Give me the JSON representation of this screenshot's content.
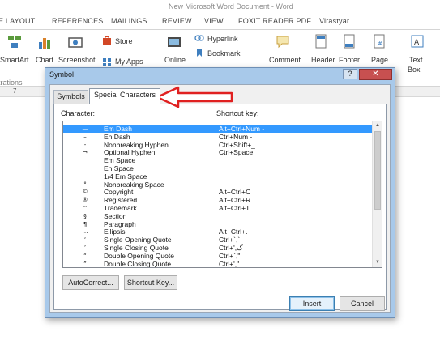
{
  "window": {
    "title": "New Microsoft Word Document - Word"
  },
  "ribbon_tabs": [
    "E LAYOUT",
    "REFERENCES",
    "MAILINGS",
    "REVIEW",
    "VIEW",
    "FOXIT READER PDF",
    "Virastyar"
  ],
  "ribbon": {
    "smartart": "SmartArt",
    "chart": "Chart",
    "screenshot": "Screenshot",
    "store": "Store",
    "my_apps": "My Apps",
    "online": "Online",
    "hyperlink": "Hyperlink",
    "bookmark": "Bookmark",
    "comment": "Comment",
    "header": "Header",
    "footer": "Footer",
    "page": "Page",
    "text_box": "Text",
    "text_box_2": "Box",
    "group_illustrations": "trations"
  },
  "ruler": {
    "mark": "7"
  },
  "dialog": {
    "title": "Symbol",
    "help": "?",
    "close": "✕",
    "tabs": [
      {
        "label": "Symbols",
        "active": false
      },
      {
        "label": "Special Characters",
        "active": true
      }
    ],
    "character_header": "Character:",
    "shortcut_header": "Shortcut key:",
    "rows": [
      {
        "char": "—",
        "name": "Em Dash",
        "shortcut": "Alt+Ctrl+Num -",
        "selected": true
      },
      {
        "char": "–",
        "name": "En Dash",
        "shortcut": "Ctrl+Num -",
        "selected": false
      },
      {
        "char": "‑",
        "name": "Nonbreaking Hyphen",
        "shortcut": "Ctrl+Shift+_",
        "selected": false
      },
      {
        "char": "¬",
        "name": "Optional Hyphen",
        "shortcut": "Ctrl+Space",
        "selected": false
      },
      {
        "char": "",
        "name": "Em Space",
        "shortcut": "",
        "selected": false
      },
      {
        "char": "",
        "name": "En Space",
        "shortcut": "",
        "selected": false
      },
      {
        "char": "",
        "name": "1/4 Em Space",
        "shortcut": "",
        "selected": false
      },
      {
        "char": "°",
        "name": "Nonbreaking Space",
        "shortcut": "",
        "selected": false
      },
      {
        "char": "©",
        "name": "Copyright",
        "shortcut": "Alt+Ctrl+C",
        "selected": false
      },
      {
        "char": "®",
        "name": "Registered",
        "shortcut": "Alt+Ctrl+R",
        "selected": false
      },
      {
        "char": "™",
        "name": "Trademark",
        "shortcut": "Alt+Ctrl+T",
        "selected": false
      },
      {
        "char": "§",
        "name": "Section",
        "shortcut": "",
        "selected": false
      },
      {
        "char": "¶",
        "name": "Paragraph",
        "shortcut": "",
        "selected": false
      },
      {
        "char": "…",
        "name": "Ellipsis",
        "shortcut": "Alt+Ctrl+.",
        "selected": false
      },
      {
        "char": "‘",
        "name": "Single Opening Quote",
        "shortcut": "Ctrl+`,`",
        "selected": false
      },
      {
        "char": "’",
        "name": "Single Closing Quote",
        "shortcut": "Ctrl+',ک",
        "selected": false
      },
      {
        "char": "“",
        "name": "Double Opening Quote",
        "shortcut": "Ctrl+`,\"",
        "selected": false
      },
      {
        "char": "”",
        "name": "Double Closing Quote",
        "shortcut": "Ctrl+',\"",
        "selected": false
      }
    ],
    "autocorrect_button": "AutoCorrect...",
    "shortcut_key_button": "Shortcut Key...",
    "insert_button": "Insert",
    "cancel_button": "Cancel"
  },
  "colors": {
    "dialog_frame": "#a8c9ea",
    "selection": "#3399ff",
    "close_button": "#c75050",
    "annotation_arrow": "#e02020"
  },
  "icons": [
    "smartart-icon",
    "chart-icon",
    "screenshot-icon",
    "store-icon",
    "hyperlink-icon",
    "bookmark-icon",
    "comment-icon",
    "header-icon",
    "footer-icon",
    "page-number-icon",
    "textbox-icon",
    "annotation-arrow"
  ]
}
